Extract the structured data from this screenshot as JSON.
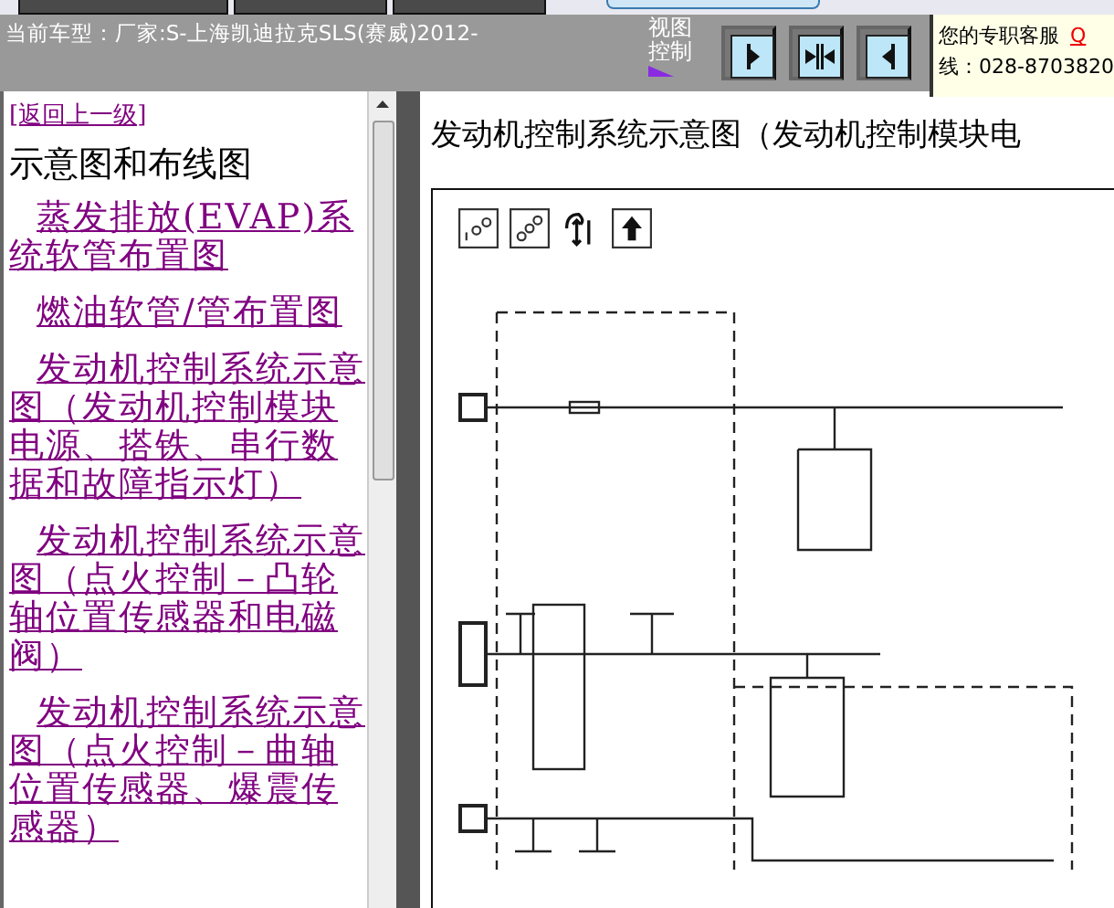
{
  "header": {
    "current_model": "当前车型：厂家:S-上海凯迪拉克SLS(赛威)2012-",
    "view_control_label": "视图控制",
    "view_buttons": [
      {
        "kind": "right"
      },
      {
        "kind": "both"
      },
      {
        "kind": "left"
      }
    ],
    "support": {
      "label": "您的专职客服",
      "qq": "Q",
      "phone": "线：028-8703820"
    }
  },
  "sidebar": {
    "back_link": "[返回上一级]",
    "heading": "示意图和布线图",
    "items": [
      {
        "label": "蒸发排放(EVAP)系统软管布置图"
      },
      {
        "label": "燃油软管/管布置图"
      },
      {
        "label": "发动机控制系统示意图（发动机控制模块电源、搭铁、串行数据和故障指示灯）"
      },
      {
        "label": "发动机控制系统示意图（点火控制－凸轮轴位置传感器和电磁阀）"
      },
      {
        "label": "发动机控制系统示意图（点火控制－曲轴位置传感器、爆震传感器）"
      }
    ]
  },
  "content": {
    "title": "发动机控制系统示意图（发动机控制模块电"
  }
}
